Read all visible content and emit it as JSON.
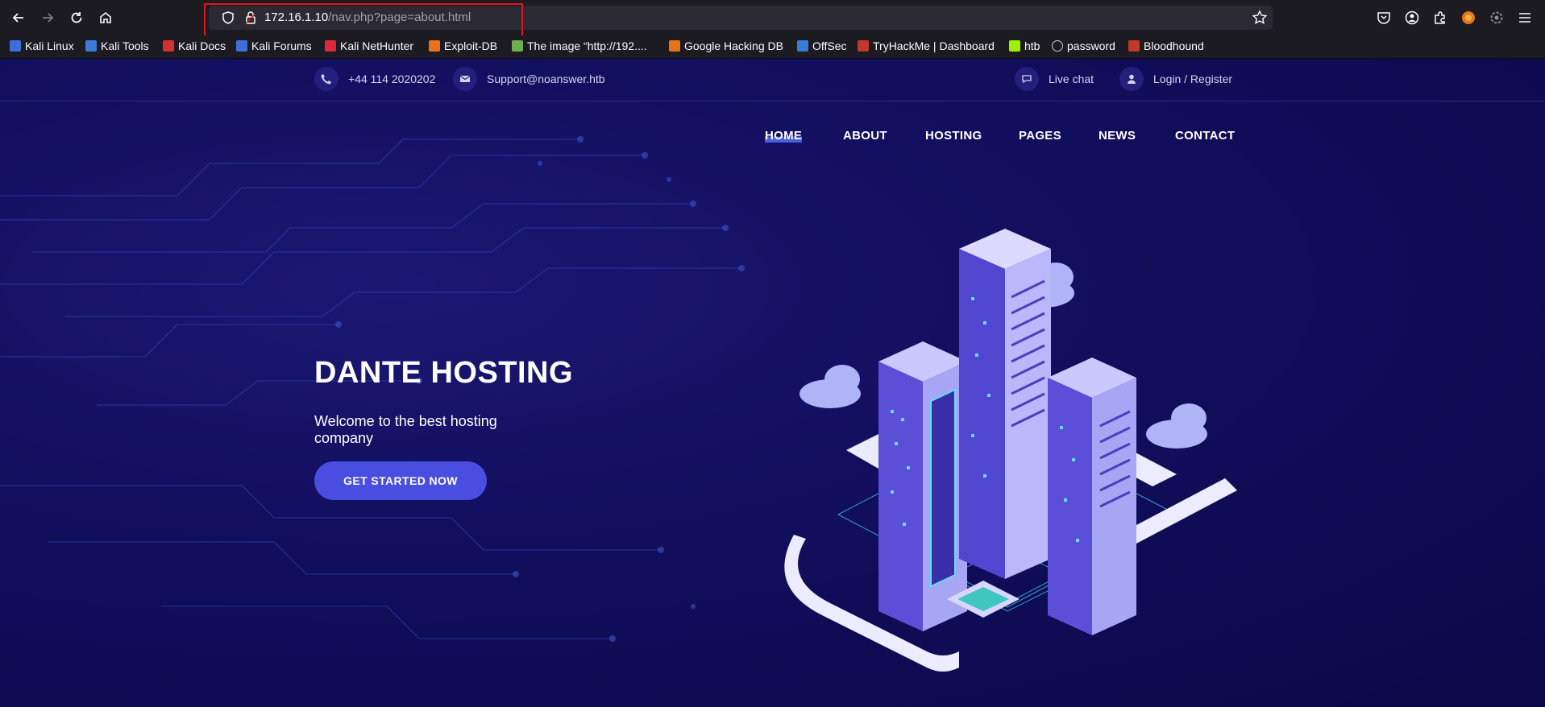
{
  "browser": {
    "url_host": "172.16.1.10",
    "url_path": "/nav.php?page=about.html"
  },
  "bookmarks": [
    {
      "label": "Kali Linux",
      "color": "#3d6fd8"
    },
    {
      "label": "Kali Tools",
      "color": "#3a7bd5"
    },
    {
      "label": "Kali Docs",
      "color": "#d3302f"
    },
    {
      "label": "Kali Forums",
      "color": "#3d6fd8"
    },
    {
      "label": "Kali NetHunter",
      "color": "#e0263b"
    },
    {
      "label": "Exploit-DB",
      "color": "#e8731a"
    },
    {
      "label": "The image “http://192....",
      "color": "#6ab04c"
    },
    {
      "label": "Google Hacking DB",
      "color": "#e8731a"
    },
    {
      "label": "OffSec",
      "color": "#3a7bd5"
    },
    {
      "label": "TryHackMe | Dashboard",
      "color": "#c0392b"
    },
    {
      "label": "htb",
      "color": "#9fef00"
    },
    {
      "label": "password",
      "color": "#cccccc"
    },
    {
      "label": "Bloodhound",
      "color": "#c0392b"
    }
  ],
  "topbar": {
    "phone": "+44 114 2020202",
    "email": "Support@noanswer.htb",
    "live_chat": "Live chat",
    "login": "Login / Register"
  },
  "menu": [
    "HOME",
    "ABOUT",
    "HOSTING",
    "PAGES",
    "NEWS",
    "CONTACT"
  ],
  "hero": {
    "title": "DANTE HOSTING",
    "subtitle": "Welcome to the best hosting company",
    "cta": "GET STARTED NOW"
  },
  "colors": {
    "accent": "#4a4ee0",
    "background": "#0d0a52",
    "url_highlight": "#e0151b"
  }
}
